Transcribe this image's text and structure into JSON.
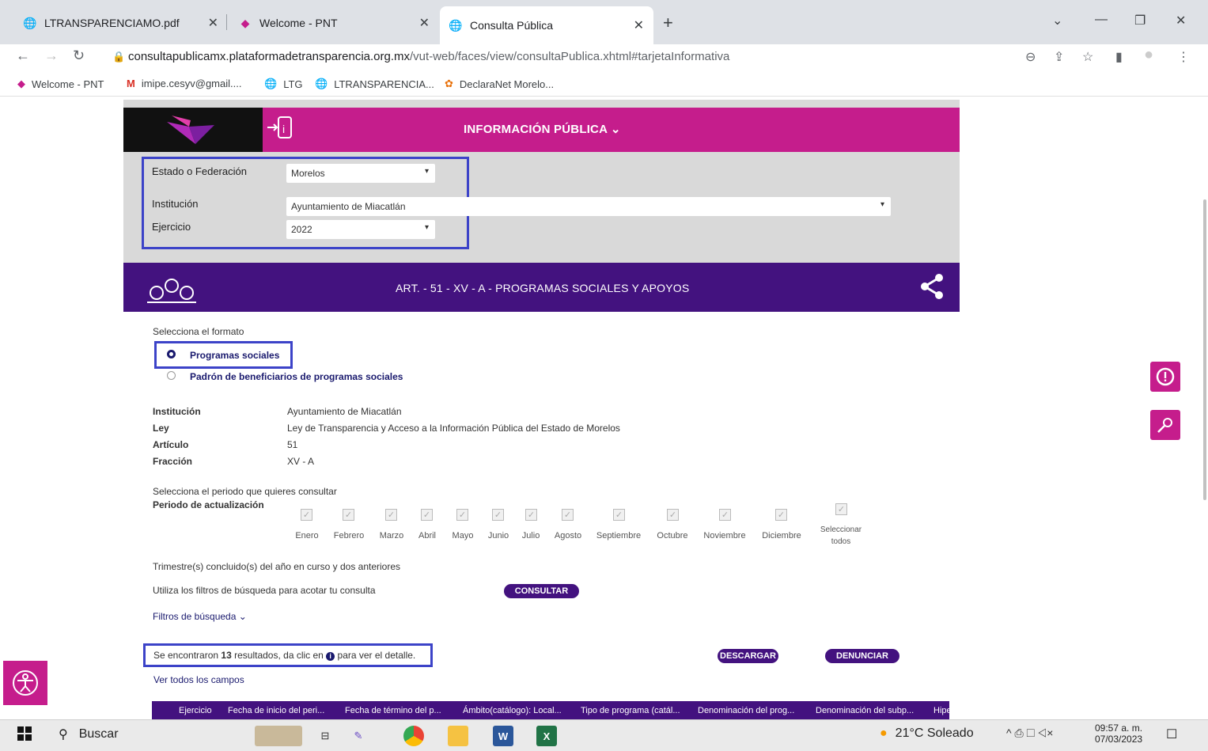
{
  "browser": {
    "tabs": [
      {
        "label": "LTRANSPARENCIAMO.pdf"
      },
      {
        "label": "Welcome - PNT"
      },
      {
        "label": "Consulta Pública"
      }
    ],
    "url_host": "consultapublicamx.plataformadetransparencia.org.mx",
    "url_path": "/vut-web/faces/view/consultaPublica.xhtml#tarjetaInformativa",
    "bookmarks": [
      {
        "label": "Welcome - PNT"
      },
      {
        "label": "imipe.cesyv@gmail...."
      },
      {
        "label": "LTG"
      },
      {
        "label": "LTRANSPARENCIA..."
      },
      {
        "label": "DeclaraNet Morelo..."
      }
    ]
  },
  "header": {
    "title": "INFORMACIÓN PÚBLICA ⌄"
  },
  "filters": {
    "estado_label": "Estado o Federación",
    "estado_value": "Morelos",
    "institucion_label": "Institución",
    "institucion_value": "Ayuntamiento de Miacatlán",
    "ejercicio_label": "Ejercicio",
    "ejercicio_value": "2022"
  },
  "banner": {
    "title": "ART. - 51 - XV - A - PROGRAMAS SOCIALES Y APOYOS"
  },
  "format": {
    "prompt": "Selecciona el formato",
    "options": [
      {
        "label": "Programas sociales",
        "selected": true
      },
      {
        "label": "Padrón de beneficiarios de programas sociales",
        "selected": false
      }
    ]
  },
  "details": [
    {
      "key": "Institución",
      "value": "Ayuntamiento de Miacatlán"
    },
    {
      "key": "Ley",
      "value": "Ley de Transparencia y Acceso a la Información Pública del Estado de Morelos"
    },
    {
      "key": "Artículo",
      "value": "51"
    },
    {
      "key": "Fracción",
      "value": "XV - A"
    }
  ],
  "period": {
    "prompt": "Selecciona el periodo que quieres consultar",
    "label": "Periodo de actualización",
    "months": [
      "Enero",
      "Febrero",
      "Marzo",
      "Abril",
      "Mayo",
      "Junio",
      "Julio",
      "Agosto",
      "Septiembre",
      "Octubre",
      "Noviembre",
      "Diciembre"
    ],
    "select_all_1": "Seleccionar",
    "select_all_2": "todos"
  },
  "notes": {
    "trimestre": "Trimestre(s) concluido(s) del año en curso y dos anteriores",
    "filtros_hint": "Utiliza los filtros de búsqueda para acotar tu consulta",
    "consultar": "CONSULTAR",
    "filtros_link": "Filtros de búsqueda ⌄"
  },
  "results": {
    "prefix": "Se encontraron",
    "count": "13",
    "suffix": "resultados, da clic en",
    "suffix2": "para ver el detalle.",
    "descargar": "DESCARGAR",
    "denunciar": "DENUNCIAR",
    "ver_todos": "Ver todos los campos"
  },
  "table_columns": [
    "Ejercicio",
    "Fecha de inicio del peri...",
    "Fecha de término del p...",
    "Ámbito(catálogo): Local...",
    "Tipo de programa (catál...",
    "Denominación del prog...",
    "Denominación del subp...",
    "Hipe"
  ],
  "taskbar": {
    "search": "Buscar",
    "weather": "21°C  Soleado",
    "time": "09:57 a. m.",
    "date": "07/03/2023"
  },
  "colors": {
    "magenta": "#c51d8c",
    "purple": "#43127f",
    "highlight": "#3c43c8"
  }
}
